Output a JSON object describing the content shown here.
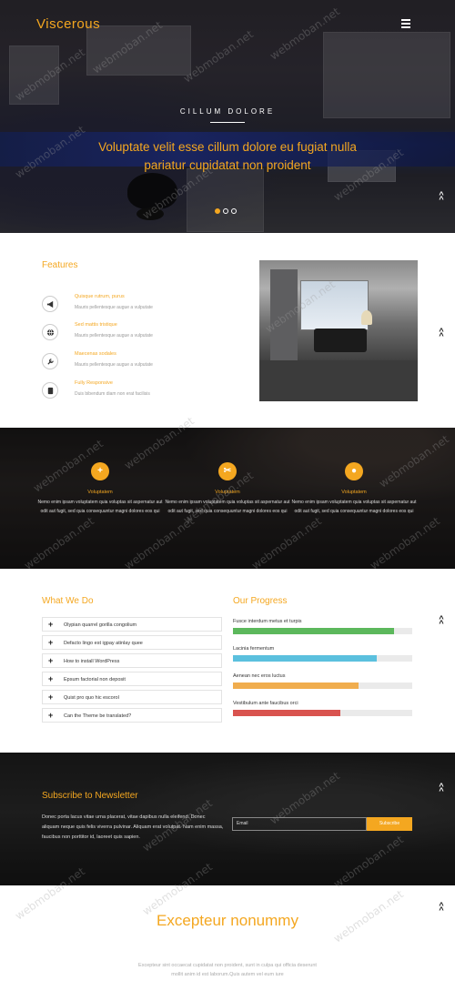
{
  "header": {
    "logo": "Viscerous",
    "menu_icon": "hamburger-menu-icon"
  },
  "hero": {
    "caption": "CILLUM DOLORE",
    "title": "Voluptate velit esse cillum dolore eu fugiat nulla pariatur cupidatat non proident",
    "slides": 3,
    "active_slide": 1
  },
  "features": {
    "title": "Features",
    "items": [
      {
        "icon": "megaphone-icon",
        "title": "Quisque rutrum, purus",
        "desc": "Mauris pellentesque augue a vulputate"
      },
      {
        "icon": "globe-icon",
        "title": "Sed mattis tristique",
        "desc": "Mauris pellentesque augue a vulputate"
      },
      {
        "icon": "wrench-icon",
        "title": "Maecenas sodales",
        "desc": "Mauris pellentesque augue a vulputate"
      },
      {
        "icon": "mobile-icon",
        "title": "Fully Responsive",
        "desc": "Duis bibendum diam non erat facilisis"
      }
    ]
  },
  "services": [
    {
      "icon": "plus-icon",
      "title": "Voluptatem",
      "desc": "Nemo enim ipsam voluptatem quia voluptas sit aspernatur aut odit aut fugit, sed quia consequuntur magni dolores eos qui"
    },
    {
      "icon": "cut-icon",
      "title": "Voluptatem",
      "desc": "Nemo enim ipsam voluptatem quia voluptas sit aspernatur aut odit aut fugit, sed quia consequuntur magni dolores eos qui"
    },
    {
      "icon": "apple-icon",
      "title": "Voluptatem",
      "desc": "Nemo enim ipsam voluptatem quia voluptas sit aspernatur aut odit aut fugit, sed quia consequuntur magni dolores eos qui"
    }
  ],
  "what_we_do": {
    "title": "What We Do",
    "items": [
      "Olypian quarrel gorilla congolium",
      "Defacto lingo est igpay atinlay quee",
      "How to install WordPress",
      "Epsum factorial non deposit",
      "Quist pro quo hic escorol",
      "Can the Theme be translated?"
    ]
  },
  "progress": {
    "title": "Our Progress",
    "bars": [
      {
        "label": "Fusce interdum metus et turpis",
        "percent": 90,
        "color": "#5cb85c"
      },
      {
        "label": "Lacinia fermentum",
        "percent": 80,
        "color": "#5bc0de"
      },
      {
        "label": "Aenean nec eros luctus",
        "percent": 70,
        "color": "#f0ad4e"
      },
      {
        "label": "Vestibulum ante faucibus orci",
        "percent": 60,
        "color": "#d9534f"
      }
    ]
  },
  "newsletter": {
    "title": "Subscribe to Newsletter",
    "text": "Donec porta lacus vitae urna placerat, vitae dapibus nulla eleifend. Donec aliquam neque quis felis viverra pulvinar. Aliquam erat volutpat. Nam enim massa, faucibus non porttitor id, laoreet quis sapien.",
    "placeholder": "Email",
    "button": "Subscribe"
  },
  "bottom": {
    "title": "Excepteur nonummy",
    "text": "Excepteur sint occaecat cupidatat non proident, sunt in culpa qui officia deserunt mollit anim id est laborum.Quis autem vel eum iure"
  },
  "watermark": "webmoban.net",
  "colors": {
    "accent": "#f4a720"
  }
}
